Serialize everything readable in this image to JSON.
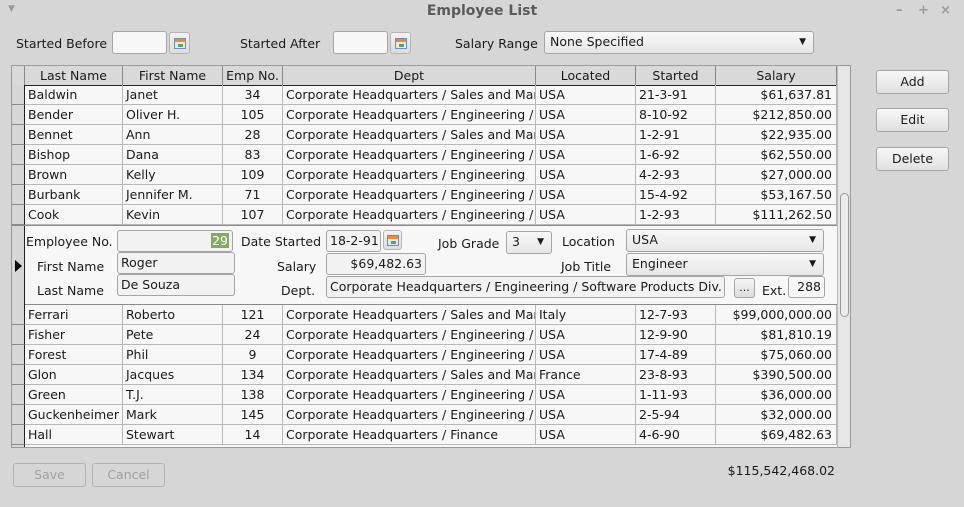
{
  "window": {
    "title": "Employee List",
    "controls": {
      "minimize": "–",
      "maximize": "+",
      "close": "×"
    },
    "menu_arrow": "▼"
  },
  "filters": {
    "started_before_label": "Started Before",
    "started_before_value": "",
    "started_after_label": "Started After",
    "started_after_value": "",
    "salary_range_label": "Salary Range",
    "salary_range_value": "None Specified"
  },
  "grid": {
    "columns": [
      "Last Name",
      "First Name",
      "Emp No.",
      "Dept",
      "Located",
      "Started",
      "Salary"
    ],
    "rows_above": [
      [
        "Baldwin",
        "Janet",
        "34",
        "Corporate Headquarters / Sales and Marketing",
        "USA",
        "21-3-91",
        "$61,637.81"
      ],
      [
        "Bender",
        "Oliver H.",
        "105",
        "Corporate Headquarters / Engineering / Software",
        "USA",
        "8-10-92",
        "$212,850.00"
      ],
      [
        "Bennet",
        "Ann",
        "28",
        "Corporate Headquarters / Sales and Marketing",
        "USA",
        "1-2-91",
        "$22,935.00"
      ],
      [
        "Bishop",
        "Dana",
        "83",
        "Corporate Headquarters / Engineering / Software",
        "USA",
        "1-6-92",
        "$62,550.00"
      ],
      [
        "Brown",
        "Kelly",
        "109",
        "Corporate Headquarters / Engineering",
        "USA",
        "4-2-93",
        "$27,000.00"
      ],
      [
        "Burbank",
        "Jennifer M.",
        "71",
        "Corporate Headquarters / Engineering / Software",
        "USA",
        "15-4-92",
        "$53,167.50"
      ],
      [
        "Cook",
        "Kevin",
        "107",
        "Corporate Headquarters / Engineering / Consumer",
        "USA",
        "1-2-93",
        "$111,262.50"
      ]
    ],
    "rows_below": [
      [
        "Ferrari",
        "Roberto",
        "121",
        "Corporate Headquarters / Sales and Marketing",
        "Italy",
        "12-7-93",
        "$99,000,000.00"
      ],
      [
        "Fisher",
        "Pete",
        "24",
        "Corporate Headquarters / Engineering / Consumer",
        "USA",
        "12-9-90",
        "$81,810.19"
      ],
      [
        "Forest",
        "Phil",
        "9",
        "Corporate Headquarters / Engineering / Software",
        "USA",
        "17-4-89",
        "$75,060.00"
      ],
      [
        "Glon",
        "Jacques",
        "134",
        "Corporate Headquarters / Sales and Marketing",
        "France",
        "23-8-93",
        "$390,500.00"
      ],
      [
        "Green",
        "T.J.",
        "138",
        "Corporate Headquarters / Engineering / Software",
        "USA",
        "1-11-93",
        "$36,000.00"
      ],
      [
        "Guckenheimer",
        "Mark",
        "145",
        "Corporate Headquarters / Engineering / Software",
        "USA",
        "2-5-94",
        "$32,000.00"
      ],
      [
        "Hall",
        "Stewart",
        "14",
        "Corporate Headquarters / Finance",
        "USA",
        "4-6-90",
        "$69,482.63"
      ]
    ]
  },
  "editor": {
    "employee_no_label": "Employee No.",
    "employee_no_value": "29",
    "first_name_label": "First Name",
    "first_name_value": "Roger",
    "last_name_label": "Last Name",
    "last_name_value": "De Souza",
    "date_started_label": "Date Started",
    "date_started_value": "18-2-91",
    "salary_label": "Salary",
    "salary_value": "$69,482.63",
    "dept_label": "Dept.",
    "dept_value": "Corporate Headquarters / Engineering / Software Products Div. / Consumer",
    "dept_browse_label": "...",
    "job_grade_label": "Job Grade",
    "job_grade_value": "3",
    "location_label": "Location",
    "location_value": "USA",
    "job_title_label": "Job Title",
    "job_title_value": "Engineer",
    "ext_label": "Ext.",
    "ext_value": "288"
  },
  "actions": {
    "add": "Add",
    "edit": "Edit",
    "delete": "Delete"
  },
  "footer": {
    "save": "Save",
    "cancel": "Cancel",
    "total": "$115,542,468.02"
  }
}
